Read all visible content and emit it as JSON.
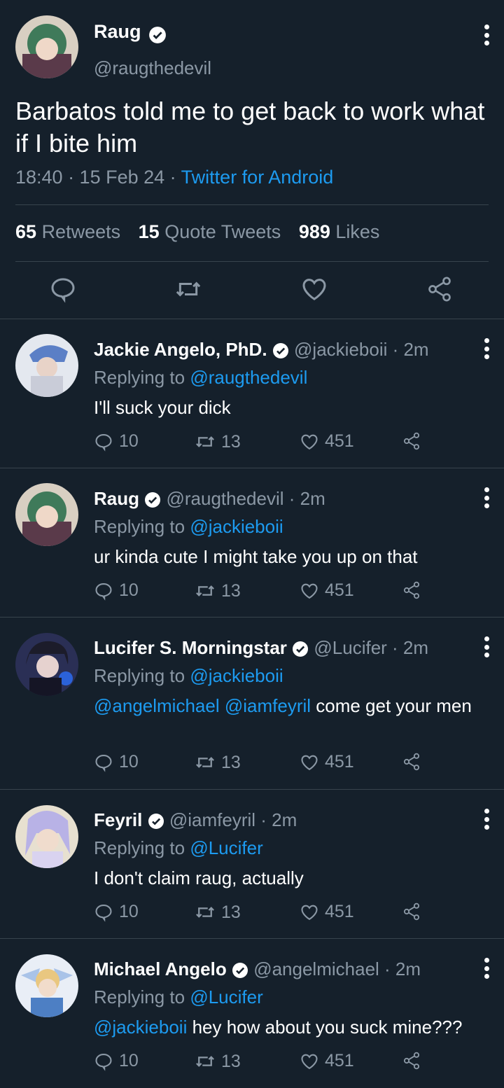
{
  "main_tweet": {
    "name": "Raug",
    "handle": "@raugthedevil",
    "text": "Barbatos told me to get back to work what if I bite him",
    "time": "18:40 · 15 Feb 24 · ",
    "source": "Twitter for Android",
    "retweets_count": "65",
    "retweets_label": "Retweets",
    "quotes_count": "15",
    "quotes_label": "Quote Tweets",
    "likes_count": "989",
    "likes_label": "Likes"
  },
  "replies": [
    {
      "name": "Jackie Angelo, PhD.",
      "handle_time": "@jackieboii · 2m",
      "replying_prefix": "Replying to ",
      "replying_to": "@raugthedevil",
      "text": "I'll suck your dick",
      "reply_count": "10",
      "retweet_count": "13",
      "like_count": "451"
    },
    {
      "name": "Raug",
      "handle_time": "@raugthedevil · 2m",
      "replying_prefix": "Replying to ",
      "replying_to": "@jackieboii",
      "text": "ur kinda cute I might take you up on that",
      "reply_count": "10",
      "retweet_count": "13",
      "like_count": "451"
    },
    {
      "name": "Lucifer S. Morningstar",
      "handle_time": "@Lucifer · 2m",
      "replying_prefix": "Replying to ",
      "replying_to": "@jackieboii",
      "mention1": "@angelmichael",
      "mention2": "@iamfeyril",
      "text": " come get your men",
      "reply_count": "10",
      "retweet_count": "13",
      "like_count": "451"
    },
    {
      "name": "Feyril",
      "handle_time": "@iamfeyril · 2m",
      "replying_prefix": "Replying to ",
      "replying_to": "@Lucifer",
      "text": "I don't claim raug, actually",
      "reply_count": "10",
      "retweet_count": "13",
      "like_count": "451"
    },
    {
      "name": "Michael Angelo",
      "handle_time": "@angelmichael · 2m",
      "replying_prefix": "Replying to ",
      "replying_to": "@Lucifer",
      "mention1": "@jackieboii",
      "text": " hey how about you suck mine???",
      "reply_count": "10",
      "retweet_count": "13",
      "like_count": "451"
    }
  ],
  "colors": {
    "background": "#15202b",
    "accent": "#1d9bf0",
    "secondary_text": "#8b98a5",
    "divider": "#38444d"
  }
}
